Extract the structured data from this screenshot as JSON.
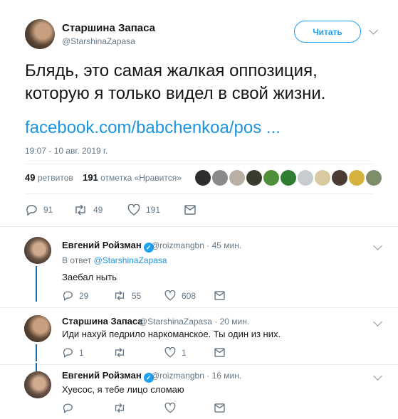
{
  "tweet": {
    "author_name": "Старшина Запаса",
    "author_handle": "@StarshinaZapasa",
    "follow_label": "Читать",
    "text": "Блядь, это самая жалкая оппозиция, которую я только видел в свой жизни.",
    "link": "facebook.com/babchenkoa/pos ...",
    "timestamp": "19:07 - 10 авг. 2019 г.",
    "retweets_count": "49",
    "retweets_label": "ретвитов",
    "likes_count": "191",
    "likes_label": "отметка «Нравится»",
    "actions": {
      "replies": "91",
      "retweets": "49",
      "likes": "191"
    }
  },
  "replies": [
    {
      "author_name": "Евгений Ройзман",
      "author_handle": "@roizmangbn",
      "time": "· 45 мин.",
      "in_reply_label": "В ответ",
      "in_reply_handle": "@StarshinaZapasa",
      "text": "Заебал ныть",
      "actions": {
        "replies": "29",
        "retweets": "55",
        "likes": "608"
      }
    },
    {
      "author_name": "Старшина Запаса",
      "author_handle": "@StarshinaZapasa",
      "time": "· 20 мин.",
      "text": "Иди нахуй педрило наркоманское. Ты один из них.",
      "actions": {
        "replies": "1",
        "retweets": "",
        "likes": "1"
      }
    },
    {
      "author_name": "Евгений Ройзман",
      "author_handle": "@roizmangbn",
      "time": "· 16 мин.",
      "text": "Хуесос, я тебе лицо сломаю",
      "actions": {
        "replies": "",
        "retweets": "",
        "likes": ""
      }
    }
  ],
  "colors": {
    "accent": "#1da1f2",
    "link": "#1b95e0",
    "muted": "#657786",
    "thread": "#1b6aa5"
  },
  "icons": [
    "reply-icon",
    "retweet-icon",
    "like-icon",
    "dm-icon",
    "chevron-down-icon",
    "verified-icon"
  ]
}
